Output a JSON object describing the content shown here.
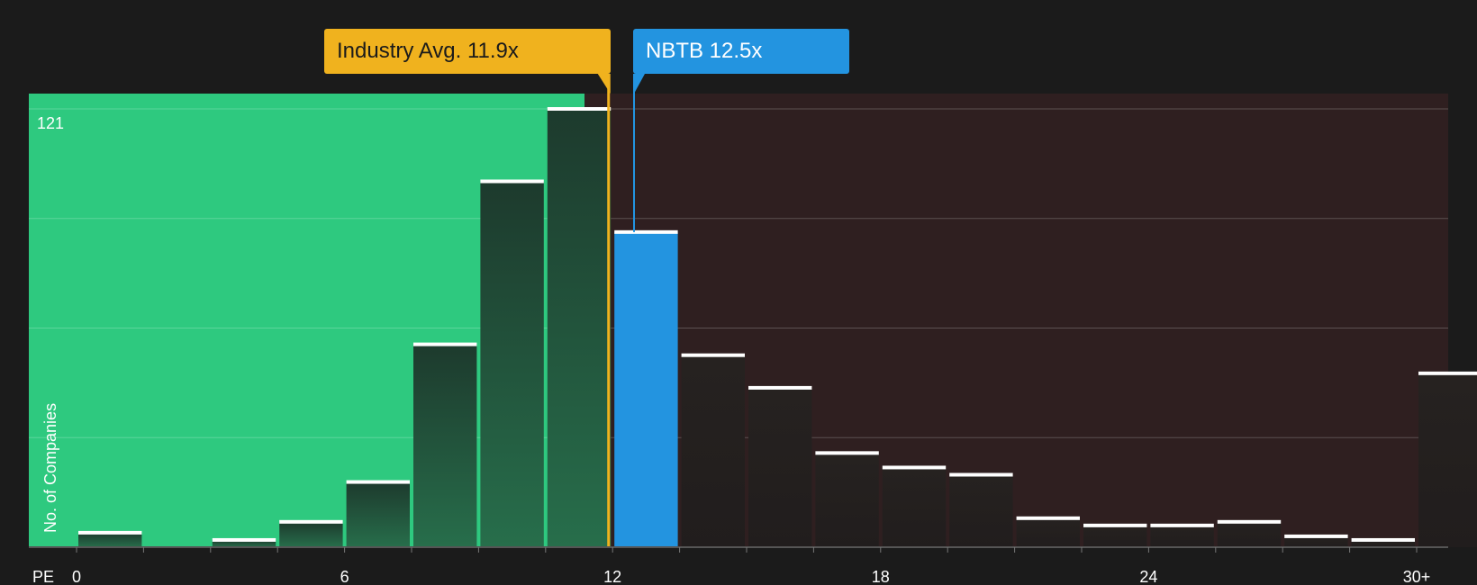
{
  "callouts": {
    "industry": "Industry Avg. 11.9x",
    "company": "NBTB 12.5x"
  },
  "colors": {
    "background": "#1b1b1b",
    "undervalued_zone": "#2ec97f",
    "overvalued_zone": "#2f1f20",
    "industry": "#f0b21e",
    "company": "#2394e0",
    "bar_dark": "#1f3b2e",
    "bar_caps": "#ffffff"
  },
  "chart_data": {
    "type": "bar",
    "xlabel": "PE",
    "ylabel": "No. of Companies",
    "x_ticks": [
      "0",
      "6",
      "12",
      "18",
      "24",
      "30+"
    ],
    "y_max_label": "121",
    "ylim": [
      0,
      121
    ],
    "bins": [
      {
        "start": 0,
        "end": 1.5,
        "value": 4
      },
      {
        "start": 1.5,
        "end": 3,
        "value": 0
      },
      {
        "start": 3,
        "end": 4.5,
        "value": 2
      },
      {
        "start": 4.5,
        "end": 6,
        "value": 7
      },
      {
        "start": 6,
        "end": 7.5,
        "value": 18
      },
      {
        "start": 7.5,
        "end": 9,
        "value": 56
      },
      {
        "start": 9,
        "end": 10.5,
        "value": 101
      },
      {
        "start": 10.5,
        "end": 12,
        "value": 121
      },
      {
        "start": 12,
        "end": 13.5,
        "value": 87
      },
      {
        "start": 13.5,
        "end": 15,
        "value": 53
      },
      {
        "start": 15,
        "end": 16.5,
        "value": 44
      },
      {
        "start": 16.5,
        "end": 18,
        "value": 26
      },
      {
        "start": 18,
        "end": 19.5,
        "value": 22
      },
      {
        "start": 19.5,
        "end": 21,
        "value": 20
      },
      {
        "start": 21,
        "end": 22.5,
        "value": 8
      },
      {
        "start": 22.5,
        "end": 24,
        "value": 6
      },
      {
        "start": 24,
        "end": 25.5,
        "value": 6
      },
      {
        "start": 25.5,
        "end": 27,
        "value": 7
      },
      {
        "start": 27,
        "end": 28.5,
        "value": 3
      },
      {
        "start": 28.5,
        "end": 30,
        "value": 2
      },
      {
        "start": 30,
        "end": 31.5,
        "value": 48
      }
    ],
    "industry_avg": 11.9,
    "company_value": 12.5,
    "company_name": "NBTB",
    "gridlines": [
      0,
      30.25,
      60.5,
      90.75,
      121
    ],
    "legend": "none"
  }
}
